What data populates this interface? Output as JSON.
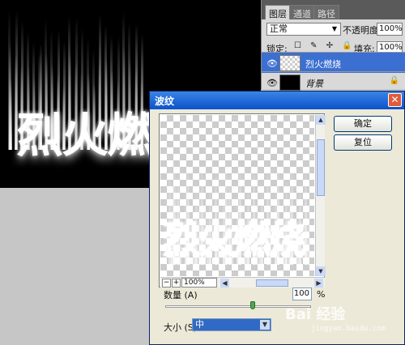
{
  "canvas": {
    "title_text": "烈火燃烧"
  },
  "layers_panel": {
    "tabs": [
      "图层",
      "通道",
      "路径"
    ],
    "blend_mode": "正常",
    "opacity_label": "不透明度:",
    "opacity_value": "100%",
    "lock_label": "锁定:",
    "lock_icons": "☐ ✎ ✢ 🔒",
    "fill_label": "填充:",
    "fill_value": "100%",
    "layers": [
      {
        "name": "烈火燃烧"
      },
      {
        "name": "背景"
      }
    ],
    "colors": {
      "selected_row": "#3b6fd1"
    }
  },
  "dialog": {
    "title": "波纹",
    "close_glyph": "✕",
    "preview_text": "烈火燃烧",
    "zoom": "100%",
    "zoom_out": "−",
    "zoom_in": "+",
    "buttons": {
      "ok": "确定",
      "reset": "复位"
    },
    "amount_label": "数量 (A)",
    "amount_value": "100",
    "amount_unit": "%",
    "amount_slider_fraction": 0.6,
    "size_label": "大小 (S)",
    "size_value": "中"
  },
  "watermark": {
    "brand": "Bai 经验",
    "url": "jingyan.baidu.com"
  }
}
